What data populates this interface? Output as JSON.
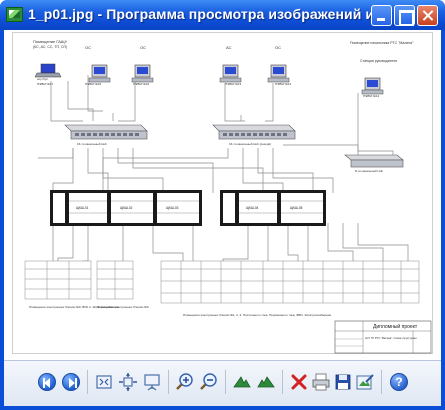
{
  "window": {
    "title": "1_p01.jpg - Программа просмотра изображений и ...",
    "minimize_label": "",
    "maximize_label": "",
    "close_label": ""
  },
  "drawing": {
    "top_left_room": "Помещение ГАЩУ",
    "top_left_sub": "(КС, АС, СС, ТП, СП)",
    "laptop_label": "ноутбук",
    "pc_labels": [
      "ПЭВМ №17",
      "ПЭВМ №15",
      "ПЭВМ №16",
      "ПЭВМ №13",
      "ПЭВМ №14"
    ],
    "top_headers": [
      "АС",
      "ОС",
      "АС",
      "ОС"
    ],
    "top_right_room": "Помещение начальника РТС \"Малина\"",
    "top_right_sub": "Станция руководителя",
    "hub_left": "16-ти канальный Hub",
    "hub_right": "16-ти канальный Hub (резерв)",
    "hub_small": "8-ти канальный Hub",
    "cabinets": [
      "ЩКШ-01",
      "ЩКШ-02",
      "ЩКШ-03",
      "ЩКШ-04",
      "ЩКШ-05"
    ],
    "left_room_1": "Помещения электронных блоков №0, ВОК 2. Электроснабжение",
    "left_room_2": "Помещения электронных блоков №0",
    "bottom_room": "Помещения электронных блоков №1, 2, 3. Постоянного тока. Переменного тока, ФВО. Электроснабжение",
    "stamp_title": "Дипломный проект",
    "stamp_sub": "АСУ ТП РТС \"Малина\". Схема структурная"
  },
  "toolbar": {
    "prev_icon": "previous-image-icon",
    "next_icon": "next-image-icon",
    "best_fit_icon": "best-fit-icon",
    "actual_size_icon": "actual-size-icon",
    "slideshow_icon": "slideshow-icon",
    "zoom_in_icon": "zoom-in-icon",
    "zoom_out_icon": "zoom-out-icon",
    "rotate_cw_icon": "rotate-clockwise-icon",
    "rotate_ccw_icon": "rotate-counterclockwise-icon",
    "delete_icon": "delete-icon",
    "print_icon": "print-icon",
    "save_icon": "save-icon",
    "edit_icon": "edit-icon",
    "help_icon": "help-icon",
    "help_text": "?"
  }
}
